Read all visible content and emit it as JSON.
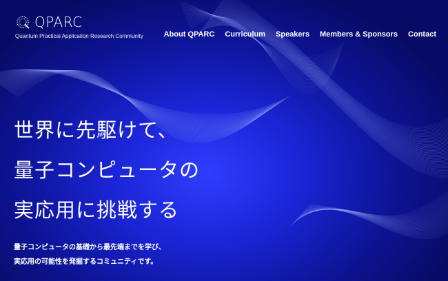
{
  "brand": {
    "name": "QPARC",
    "tagline": "Quantum Practical Application Research Community"
  },
  "nav": {
    "items": [
      "About QPARC",
      "Curriculum",
      "Speakers",
      "Members & Sponsors",
      "Contact"
    ]
  },
  "hero": {
    "headline": [
      "世界に先駆けて、",
      "量子コンピュータの",
      "実応用に挑戦する"
    ],
    "lead": [
      "量子コンピュータの基礎から最先端までを学び、",
      "実応用の可能性を発掘するコミュニティです。"
    ]
  },
  "colors": {
    "background_center": "#2f3dff",
    "background_edge": "#070b66",
    "text": "#ffffff"
  }
}
